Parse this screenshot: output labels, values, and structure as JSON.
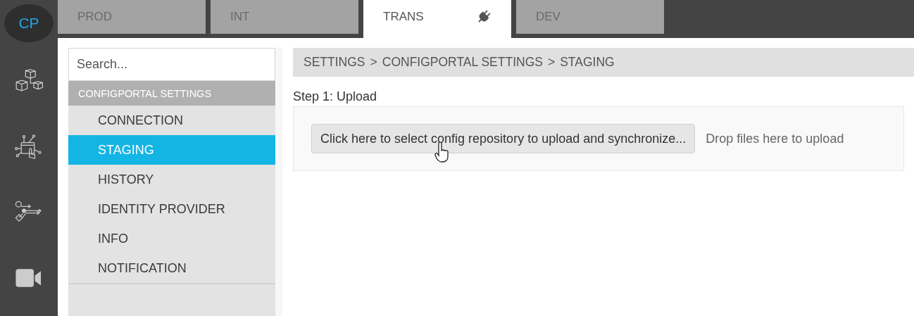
{
  "rail": {
    "logo": "CP",
    "items": [
      {
        "kind": "cubes"
      },
      {
        "kind": "network"
      },
      {
        "kind": "flow"
      },
      {
        "kind": "video"
      }
    ]
  },
  "env_tabs": [
    {
      "label": "PROD",
      "selected": false,
      "connected": false
    },
    {
      "label": "INT",
      "selected": false,
      "connected": false
    },
    {
      "label": "TRANS",
      "selected": true,
      "connected": true
    },
    {
      "label": "DEV",
      "selected": false,
      "connected": false
    }
  ],
  "sidebar": {
    "search": {
      "placeholder": "Search..."
    },
    "section": "CONFIGPORTAL SETTINGS",
    "items": [
      {
        "label": "CONNECTION",
        "selected": false
      },
      {
        "label": "STAGING",
        "selected": true
      },
      {
        "label": "HISTORY",
        "selected": false
      },
      {
        "label": "IDENTITY PROVIDER",
        "selected": false
      },
      {
        "label": "INFO",
        "selected": false
      },
      {
        "label": "NOTIFICATION",
        "selected": false
      }
    ]
  },
  "breadcrumb": [
    "SETTINGS",
    "CONFIGPORTAL SETTINGS",
    "STAGING"
  ],
  "breadcrumb_separator": ">",
  "step": {
    "title": "Step 1: Upload",
    "button": "Click here to select config repository to upload and synchronize...",
    "drop_hint": "Drop files here to upload"
  }
}
